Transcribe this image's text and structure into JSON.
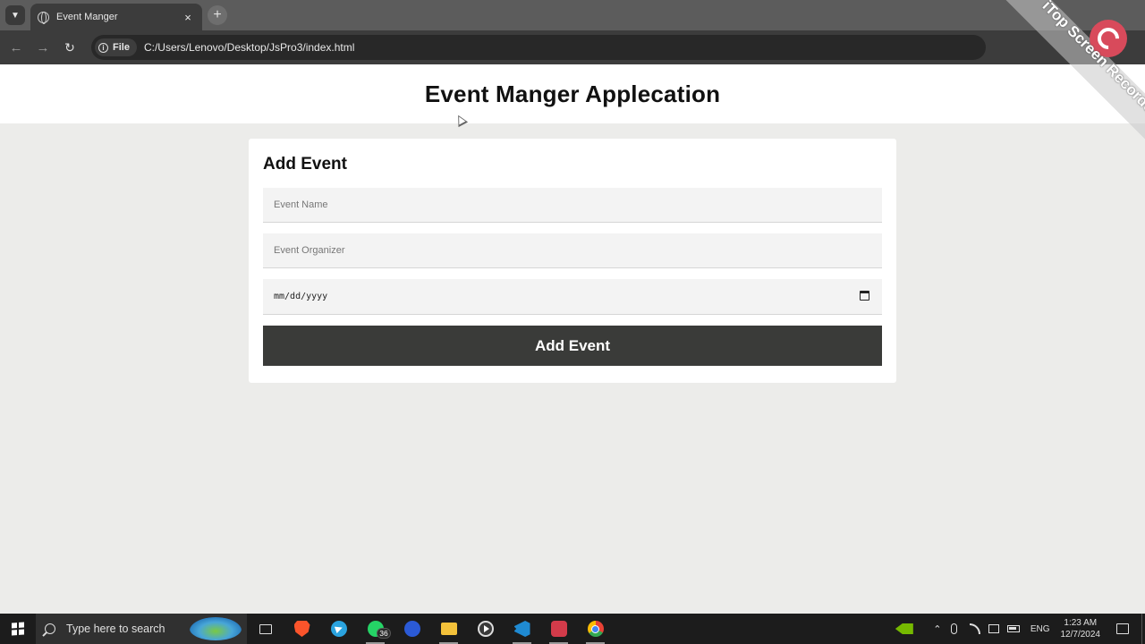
{
  "browser": {
    "tab_title": "Event Manger",
    "tab_close": "×",
    "new_tab": "+",
    "file_chip_label": "File",
    "url": "C:/Users/Lenovo/Desktop/JsPro3/index.html",
    "icons": [
      "back-arrow-icon",
      "forward-arrow-icon",
      "reload-icon",
      "info-icon",
      "globe-icon"
    ]
  },
  "page": {
    "title": "Event Manger Applecation",
    "form": {
      "heading": "Add Event",
      "event_name_placeholder": "Event Name",
      "event_organizer_placeholder": "Event Organizer",
      "date_placeholder": "mm/dd/yyyy",
      "submit_label": "Add Event"
    }
  },
  "watermark": {
    "text": "iTop Screen Recorder"
  },
  "taskbar": {
    "search_placeholder": "Type here to search",
    "whatsapp_badge": "36",
    "language": "ENG",
    "time": "1:23 AM",
    "date": "12/7/2024"
  },
  "colors": {
    "submit_button": "#3a3b39",
    "page_background": "#ececea",
    "card_background": "#ffffff",
    "field_background": "#f3f3f3"
  }
}
